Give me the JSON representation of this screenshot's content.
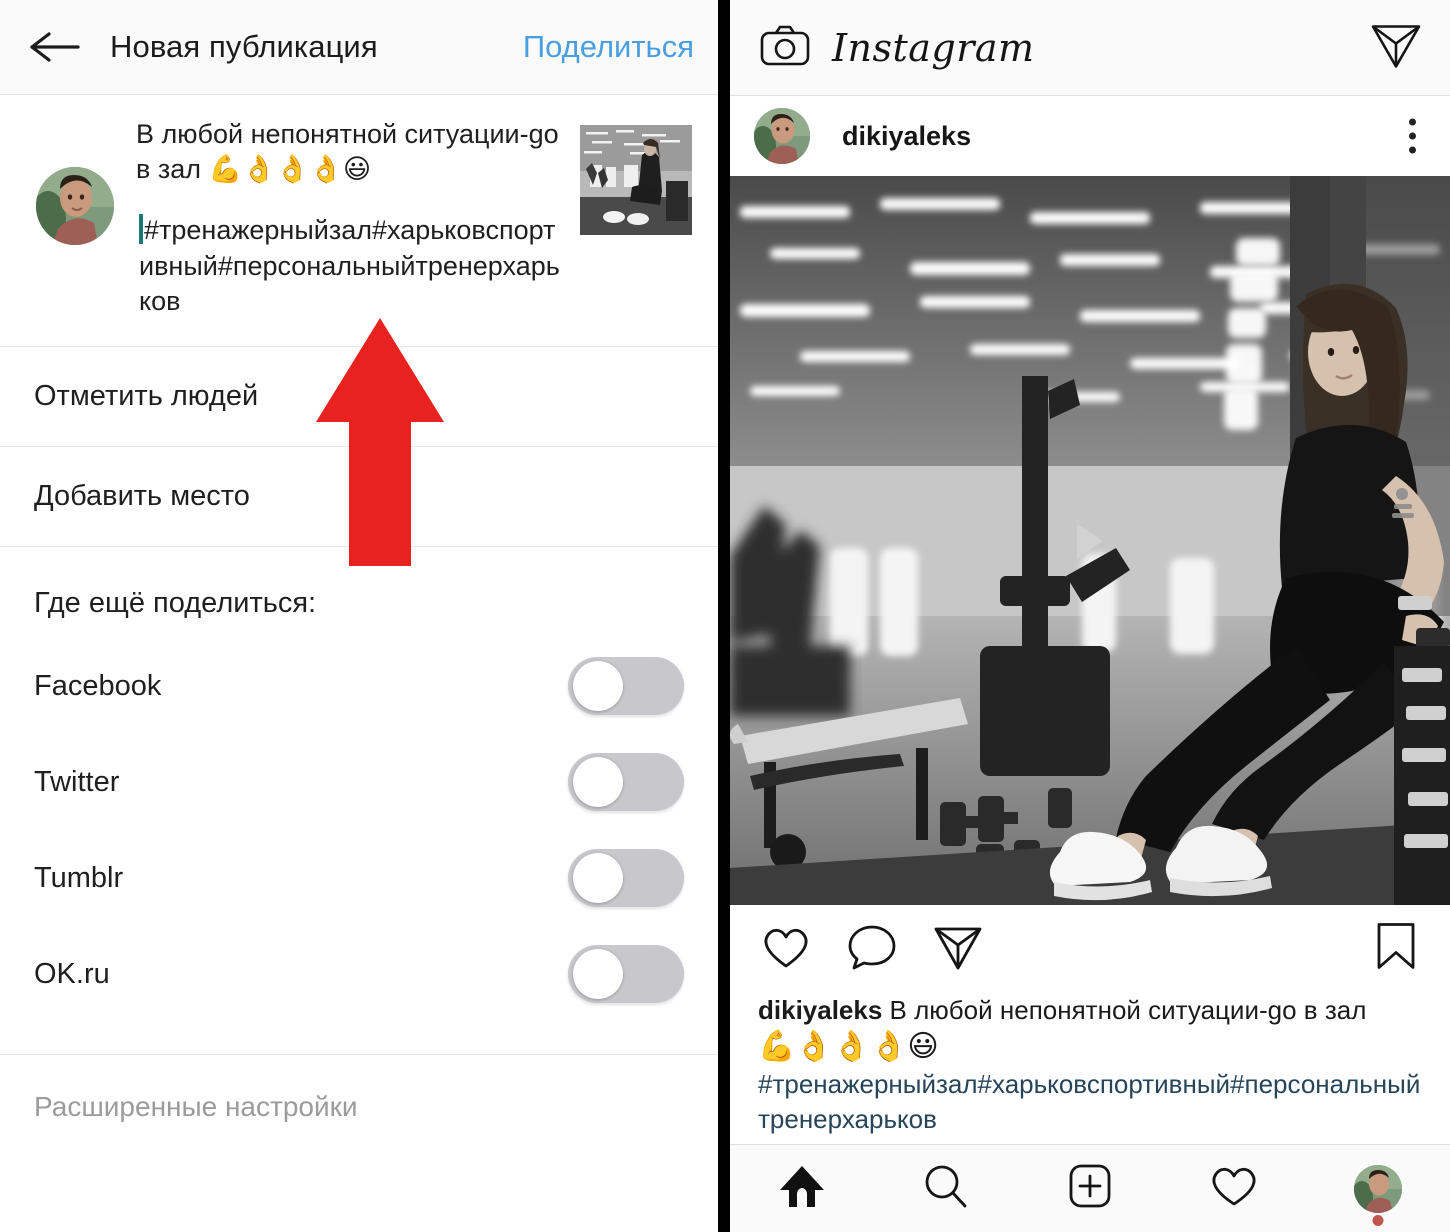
{
  "left_panel": {
    "appbar": {
      "back_icon": "back-arrow-icon",
      "title": "Новая публикация",
      "share_label": "Поделиться"
    },
    "composer": {
      "caption_line": "В любой непонятной ситуации-go в зал 💪👌👌👌😃",
      "caption_text": "В любой непонятной ситуации-go в зал",
      "caption_emoji": "💪👌👌👌😃",
      "hashtags": "#тренажерныйзал#харьковспортивный#персональныйтренерхарьков",
      "caret_color": "#197a77",
      "thumbnail_alt": "gym-photo-thumbnail",
      "avatar_alt": "user-avatar"
    },
    "options": [
      {
        "label": "Отметить людей"
      },
      {
        "label": "Добавить место"
      }
    ],
    "share_section": {
      "heading": "Где ещё поделиться:",
      "targets": [
        {
          "label": "Facebook",
          "enabled": false
        },
        {
          "label": "Twitter",
          "enabled": false
        },
        {
          "label": "Tumblr",
          "enabled": false
        },
        {
          "label": "OK.ru",
          "enabled": false
        }
      ]
    },
    "advanced_label": "Расширенные настройки",
    "annotation": {
      "shape": "up-arrow",
      "color": "#e8221f"
    }
  },
  "right_panel": {
    "appbar": {
      "camera_icon": "camera-icon",
      "wordmark": "Instagram",
      "send_icon": "send-icon"
    },
    "post": {
      "username": "dikiyaleks",
      "more_icon": "more-vertical-icon",
      "media_alt": "gym-photo-black-and-white",
      "is_video": true,
      "actions": {
        "like": "heart-icon",
        "comment": "comment-icon",
        "share": "send-icon",
        "save": "bookmark-icon"
      },
      "caption": {
        "username": "dikiyaleks",
        "text": "В любой непонятной ситуации-go в зал",
        "emoji": "💪👌👌👌😃",
        "hashtags": "#тренажерныйзал#харьковспортивный#персональныйтренерхарьков",
        "hashtag_color": "#26455a"
      }
    },
    "tabbar": [
      {
        "icon": "home-icon",
        "active": true
      },
      {
        "icon": "search-icon",
        "active": false
      },
      {
        "icon": "add-post-icon",
        "active": false
      },
      {
        "icon": "heart-icon",
        "active": false
      },
      {
        "icon": "profile-avatar-icon",
        "active": false,
        "badge": true
      }
    ]
  }
}
